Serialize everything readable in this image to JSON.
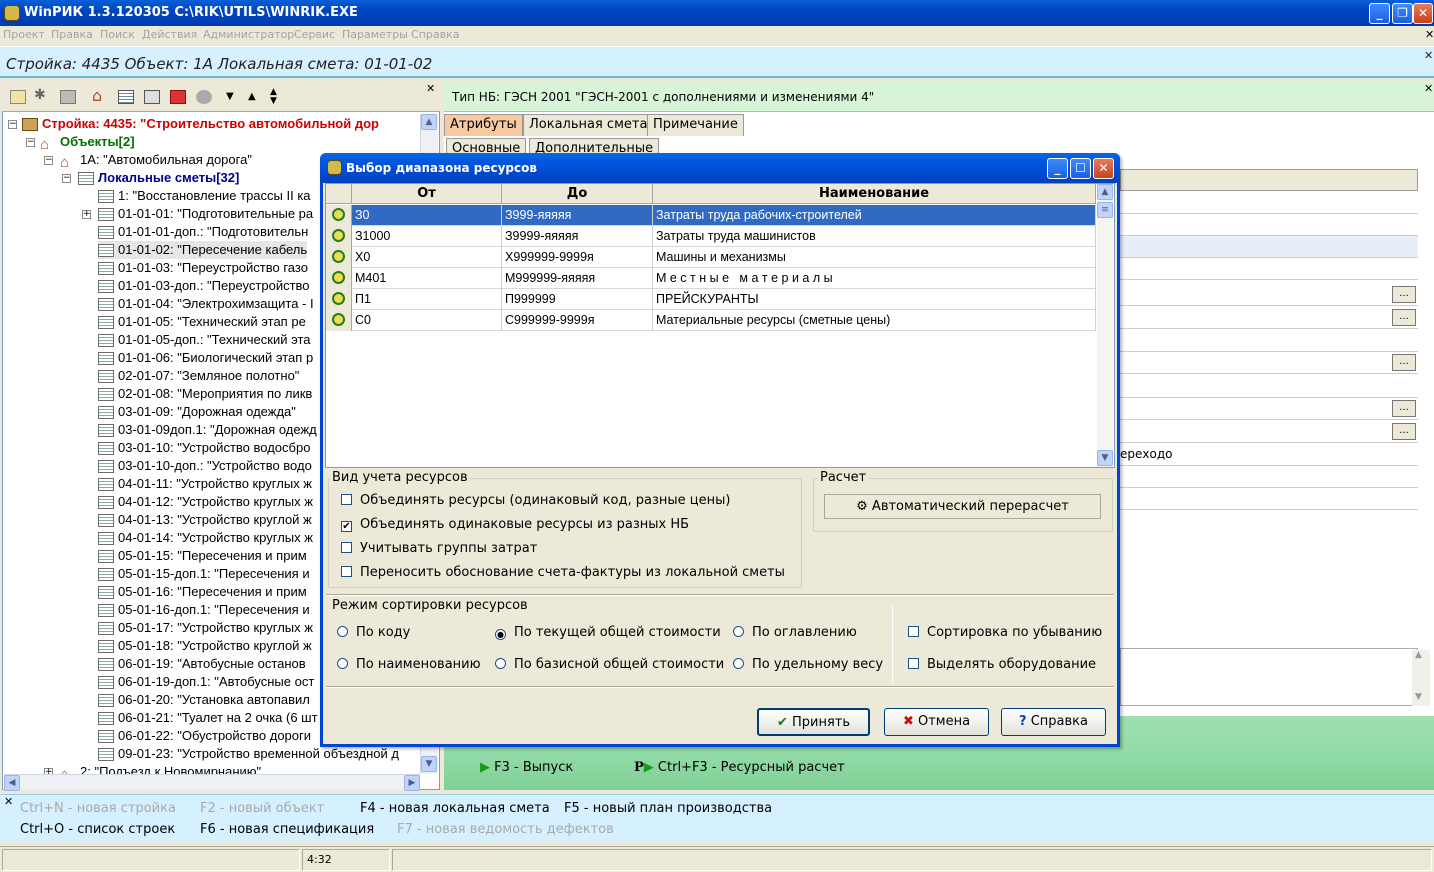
{
  "window": {
    "title": "WinРИК 1.3.120305   C:\\RIK\\UTILS\\WINRIK.EXE"
  },
  "menu": [
    "Проект",
    "Правка",
    "Поиск",
    "Действия",
    "Администратор",
    "Сервис",
    "Параметры",
    "Справка"
  ],
  "breadcrumb": "Стройка: 4435  Объект: 1А  Локальная смета: 01-01-02",
  "tree": {
    "root": "Стройка: 4435: \"Строительство автомобильной дор",
    "objects": "Объекты[2]",
    "object1": "1А: \"Автомобильная дорога\"",
    "estimates": "Локальные сметы[32]",
    "items": [
      "1: \"Восстановление трассы II ка",
      "01-01-01: \"Подготовительные ра",
      "01-01-01-доп.: \"Подготовительн",
      "01-01-02: \"Пересечение кабель",
      "01-01-03: \"Переустройство газо",
      "01-01-03-доп.: \"Переустройство",
      "01-01-04: \"Электрохимзащита - I",
      "01-01-05: \"Технический этап ре",
      "01-01-05-доп.: \"Технический эта",
      "01-01-06: \"Биологический этап р",
      "02-01-07: \"Земляное полотно\"",
      "02-01-08: \"Мероприятия по ликв",
      "03-01-09: \"Дорожная одежда\"",
      "03-01-09доп.1: \"Дорожная одежд",
      "03-01-10: \"Устройство водосбро",
      "03-01-10-доп.: \"Устройство водо",
      "04-01-11: \"Устройство круглых ж",
      "04-01-12: \"Устройство круглых ж",
      "04-01-13: \"Устройство круглой ж",
      "04-01-14: \"Устройство круглых ж",
      "05-01-15: \"Пересечения и прим",
      "05-01-15-доп.1: \"Пересечения и",
      "05-01-16: \"Пересечения и прим",
      "05-01-16-доп.1: \"Пересечения и",
      "05-01-17: \"Устройство круглых ж",
      "05-01-18: \"Устройство круглой ж",
      "06-01-19: \"Автобусные останов",
      "06-01-19-доп.1: \"Автобусные ост",
      "06-01-20: \"Установка автопавил",
      "06-01-21: \"Туалет на 2 очка (6 шт",
      "06-01-22: \"Обустройство дороги",
      "09-01-23: \"Устройство временной объездной д"
    ],
    "object2": "2: \"Подъезд к Новомирнанию\""
  },
  "right": {
    "nb_type": "Тип НБ: ГЭСН 2001 \"ГЭСН-2001 с дополнениями и изменениями 4\"",
    "tabs": [
      "Атрибуты",
      "Локальная смета",
      "Примечание"
    ],
    "subtabs": [
      "Основные",
      "Дополнительные"
    ],
    "cell_text": "ереходо",
    "dots": "..."
  },
  "fkeys": {
    "f3": "F3 - Выпуск",
    "ctrlf3": "Ctrl+F3 - Ресурсный расчет",
    "p_icon": "P"
  },
  "bottom": {
    "ctrl_n": "Ctrl+N - новая стройка",
    "f2": "F2 - новый объект",
    "f4": "F4 - новая локальная смета",
    "f5": "F5 - новый план производства",
    "ctrl_o": "Ctrl+O - список строек",
    "f6": "F6 - новая спецификация",
    "f7": "F7 - новая ведомость дефектов"
  },
  "status": {
    "time": "4:32"
  },
  "dialog": {
    "title": "Выбор диапазона ресурсов",
    "columns": [
      "От",
      "До",
      "Наименование"
    ],
    "rows": [
      {
        "from": "З0",
        "to": "З999-яяяяя",
        "name": "Затраты труда рабочих-строителей"
      },
      {
        "from": "З1000",
        "to": "З9999-яяяяя",
        "name": "Затраты труда машинистов"
      },
      {
        "from": "Х0",
        "to": "Х999999-9999я",
        "name": "Машины и механизмы"
      },
      {
        "from": "М401",
        "to": "М999999-яяяяя",
        "name": "М е с т н ы е   м а т е р и а л ы"
      },
      {
        "from": "П1",
        "to": "П999999",
        "name": "ПРЕЙСКУРАНТЫ"
      },
      {
        "from": "С0",
        "to": "С999999-9999я",
        "name": "Материальные ресурсы (сметные цены)"
      }
    ],
    "group_account": {
      "title": "Вид учета ресурсов",
      "options": [
        {
          "label": "Объединять ресурсы (одинаковый код, разные цены)",
          "checked": false
        },
        {
          "label": "Объединять одинаковые ресурсы из разных НБ",
          "checked": true
        },
        {
          "label": "Учитывать группы затрат",
          "checked": false
        },
        {
          "label": "Переносить обоснование счета-фактуры из локальной сметы",
          "checked": false
        }
      ]
    },
    "group_calc": {
      "title": "Расчет",
      "button": "Автоматический перерасчет"
    },
    "group_sort": {
      "title": "Режим сортировки ресурсов",
      "radios": [
        {
          "label": "По коду",
          "checked": false
        },
        {
          "label": "По текущей общей стоимости",
          "checked": true
        },
        {
          "label": "По оглавлению",
          "checked": false
        },
        {
          "label": "По наименованию",
          "checked": false
        },
        {
          "label": "По базисной общей стоимости",
          "checked": false
        },
        {
          "label": "По удельному весу",
          "checked": false
        }
      ],
      "checks": [
        {
          "label": "Сортировка по убыванию",
          "checked": false
        },
        {
          "label": "Выделять оборудование",
          "checked": false
        }
      ]
    },
    "buttons": {
      "ok": "Принять",
      "cancel": "Отмена",
      "help": "Справка"
    }
  }
}
